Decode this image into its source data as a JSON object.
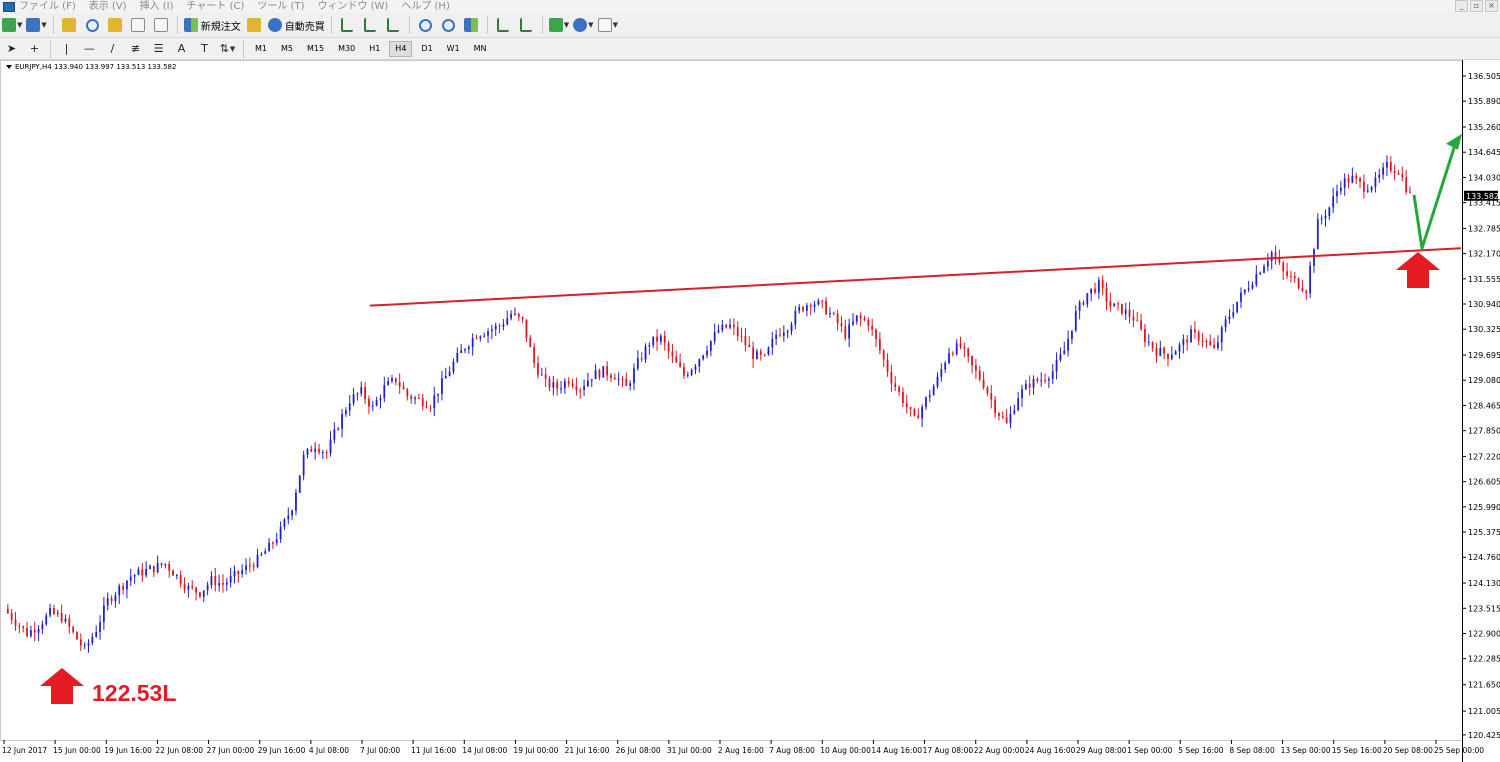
{
  "menu": {
    "items": [
      "ファイル (F)",
      "表示 (V)",
      "挿入 (I)",
      "チャート (C)",
      "ツール (T)",
      "ウィンドウ (W)",
      "ヘルプ (H)"
    ],
    "window_controls": [
      "_",
      "▫",
      "×"
    ]
  },
  "toolbar": {
    "new_order_label": "新規注文",
    "auto_trade_label": "自動売買",
    "timeframes": [
      "M1",
      "M5",
      "M15",
      "M30",
      "H1",
      "H4",
      "D1",
      "W1",
      "MN"
    ],
    "active_timeframe": "H4",
    "line_tools": [
      "|",
      "—",
      "/",
      "A",
      "T"
    ]
  },
  "chart": {
    "info_text": "EURJPY,H4  133.940 133.997 133.513 133.582",
    "current_price": "133.582",
    "annotation": "122.53L"
  },
  "chart_data": {
    "type": "candlestick",
    "symbol": "EURJPY",
    "timeframe": "H4",
    "ohlc_last": {
      "open": 133.94,
      "high": 133.997,
      "low": 133.513,
      "close": 133.582
    },
    "ylim": [
      120.3,
      136.7
    ],
    "y_ticks": [
      "136.505",
      "135.890",
      "135.260",
      "134.645",
      "134.030",
      "133.415",
      "132.785",
      "132.170",
      "131.555",
      "130.940",
      "130.325",
      "129.695",
      "129.080",
      "128.465",
      "127.850",
      "127.220",
      "126.605",
      "125.990",
      "125.375",
      "124.760",
      "124.130",
      "123.515",
      "122.900",
      "122.285",
      "121.650",
      "121.005",
      "120.425"
    ],
    "x_ticks": [
      "12 Jun 2017",
      "15 Jun 00:00",
      "19 Jun 16:00",
      "22 Jun 08:00",
      "27 Jun 00:00",
      "29 Jun 16:00",
      "4 Jul 08:00",
      "7 Jul 00:00",
      "11 Jul 16:00",
      "14 Jul 08:00",
      "19 Jul 00:00",
      "21 Jul 16:00",
      "26 Jul 08:00",
      "31 Jul 00:00",
      "2 Aug 16:00",
      "7 Aug 08:00",
      "10 Aug 00:00",
      "14 Aug 16:00",
      "17 Aug 08:00",
      "22 Aug 00:00",
      "24 Aug 16:00",
      "29 Aug 08:00",
      "1 Sep 00:00",
      "5 Sep 16:00",
      "8 Sep 08:00",
      "13 Sep 00:00",
      "15 Sep 16:00",
      "20 Sep 08:00",
      "25 Sep 00:00"
    ],
    "price_path": [
      123.5,
      123.2,
      122.9,
      123.1,
      123.4,
      123.3,
      122.9,
      122.5,
      123.0,
      123.7,
      124.0,
      124.3,
      124.4,
      124.5,
      124.6,
      124.3,
      124.0,
      123.9,
      124.2,
      124.1,
      124.3,
      124.5,
      124.7,
      125.0,
      125.4,
      126.0,
      127.2,
      127.5,
      127.3,
      128.0,
      128.6,
      128.8,
      128.4,
      128.9,
      129.1,
      128.7,
      128.6,
      128.5,
      129.0,
      129.5,
      129.9,
      130.2,
      130.3,
      130.4,
      130.7,
      130.5,
      129.5,
      129.0,
      128.9,
      129.1,
      128.9,
      129.2,
      129.3,
      129.2,
      128.9,
      129.5,
      130.0,
      130.1,
      129.6,
      129.2,
      129.5,
      129.9,
      130.3,
      130.4,
      130.1,
      129.7,
      129.6,
      130.2,
      130.4,
      130.8,
      131.0,
      130.9,
      130.6,
      130.2,
      130.6,
      130.5,
      129.8,
      129.1,
      128.6,
      128.1,
      128.6,
      129.1,
      129.8,
      129.9,
      129.4,
      129.0,
      128.4,
      128.0,
      128.7,
      129.0,
      129.1,
      129.3,
      129.8,
      130.7,
      131.2,
      131.4,
      130.9,
      130.8,
      130.6,
      130.1,
      129.8,
      129.7,
      129.9,
      130.2,
      130.1,
      129.8,
      130.5,
      131.0,
      131.4,
      131.8,
      132.2,
      131.7,
      131.5,
      131.3,
      132.9,
      133.3,
      133.9,
      134.0,
      133.8,
      133.9,
      134.3,
      134.2,
      133.6
    ],
    "resistance_line": {
      "from": {
        "x": "7 Jul 00:00",
        "y": 130.9
      },
      "to": {
        "x": "25 Sep 00:00",
        "y": 132.3
      }
    },
    "projection_arrow": {
      "from": 133.6,
      "via": 132.3,
      "to": 134.9
    },
    "marker_arrows": [
      "122.53 low",
      "breakout retest"
    ],
    "colors": {
      "bull": "#1f1fd2",
      "bear": "#e0141e",
      "trendline": "#dc1e28",
      "projection": "#22a83a",
      "marker": "#e51b24"
    }
  }
}
